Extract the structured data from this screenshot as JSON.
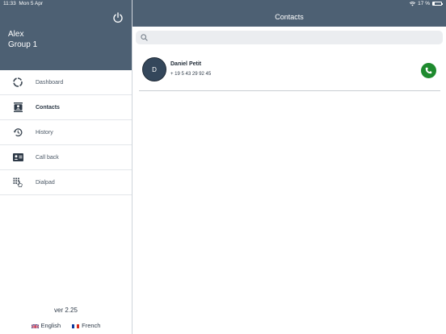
{
  "status": {
    "time": "11:33",
    "date": "Mon 5 Apr",
    "battery_percent": "17 %",
    "battery_level": 0.17,
    "wifi_icon": "wifi-icon"
  },
  "profile": {
    "name": "Alex",
    "group": "Group 1",
    "logout_icon": "power-icon"
  },
  "menu": [
    {
      "label": "Dashboard",
      "icon": "dashboard-icon",
      "active": false
    },
    {
      "label": "Contacts",
      "icon": "contacts-icon",
      "active": true
    },
    {
      "label": "History",
      "icon": "history-icon",
      "active": false
    },
    {
      "label": "Call back",
      "icon": "callback-icon",
      "active": false
    },
    {
      "label": "Dialpad",
      "icon": "dialpad-icon",
      "active": false
    }
  ],
  "footer": {
    "version": "ver 2.25",
    "languages": [
      {
        "label": "English",
        "flag": "uk-flag-icon"
      },
      {
        "label": "French",
        "flag": "fr-flag-icon"
      }
    ]
  },
  "header": {
    "title": "Contacts"
  },
  "search": {
    "placeholder": "",
    "value": ""
  },
  "contacts": [
    {
      "initial": "D",
      "name": "Daniel Petit",
      "phone": "+ 19 5 43 29 92 45"
    }
  ],
  "colors": {
    "header_bg": "#4d6073",
    "call_button": "#1e8a2e",
    "avatar_bg": "#34475b"
  }
}
